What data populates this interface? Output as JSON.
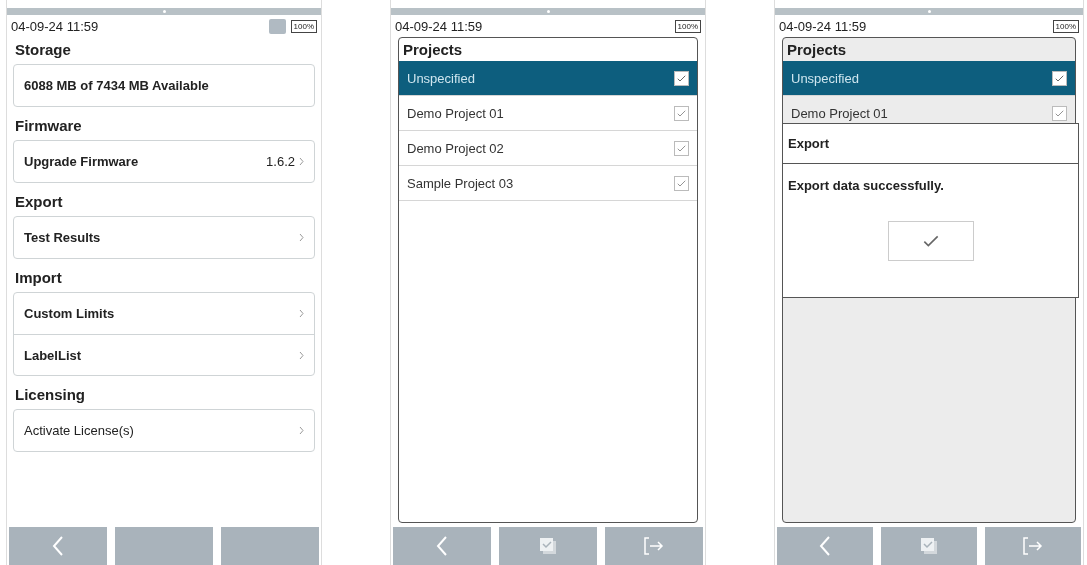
{
  "screens": [
    {
      "kind": "settings",
      "status": {
        "time": "04-09-24 11:59",
        "usb": true,
        "battery": "100%"
      },
      "sections": [
        {
          "title": "Storage",
          "rows": [
            {
              "label": "6088 MB of 7434 MB Available",
              "bold": true,
              "chevron": false
            }
          ]
        },
        {
          "title": "Firmware",
          "rows": [
            {
              "label": "Upgrade Firmware",
              "value": "1.6.2",
              "bold": true,
              "chevron": true
            }
          ]
        },
        {
          "title": "Export",
          "rows": [
            {
              "label": "Test Results",
              "bold": true,
              "chevron": true
            }
          ]
        },
        {
          "title": "Import",
          "rows": [
            {
              "label": "Custom Limits",
              "bold": true,
              "chevron": true
            },
            {
              "label": "LabelList",
              "bold": true,
              "chevron": true
            }
          ]
        },
        {
          "title": "Licensing",
          "rows": [
            {
              "label": "Activate License(s)",
              "bold": false,
              "chevron": true
            }
          ]
        }
      ],
      "footer": [
        {
          "kind": "back"
        },
        {
          "kind": "blank"
        },
        {
          "kind": "blank"
        }
      ]
    },
    {
      "kind": "projects",
      "status": {
        "time": "04-09-24 11:59",
        "usb": false,
        "battery": "100%"
      },
      "title": "Projects",
      "dimmed": false,
      "items": [
        {
          "label": "Unspecified",
          "selected": true,
          "checked": true
        },
        {
          "label": "Demo Project 01",
          "selected": false,
          "checked": true
        },
        {
          "label": "Demo Project 02",
          "selected": false,
          "checked": true
        },
        {
          "label": "Sample Project 03",
          "selected": false,
          "checked": true
        }
      ],
      "footer": [
        {
          "kind": "back"
        },
        {
          "kind": "select-all"
        },
        {
          "kind": "exit"
        }
      ]
    },
    {
      "kind": "projects",
      "status": {
        "time": "04-09-24 11:59",
        "usb": false,
        "battery": "100%"
      },
      "title": "Projects",
      "dimmed": true,
      "items": [
        {
          "label": "Unspecified",
          "selected": true,
          "checked": true
        },
        {
          "label": "Demo Project 01",
          "selected": false,
          "checked": true
        }
      ],
      "dialog": {
        "title": "Export",
        "message": "Export data successfully."
      },
      "footer": [
        {
          "kind": "back"
        },
        {
          "kind": "select-all"
        },
        {
          "kind": "exit"
        }
      ]
    }
  ]
}
